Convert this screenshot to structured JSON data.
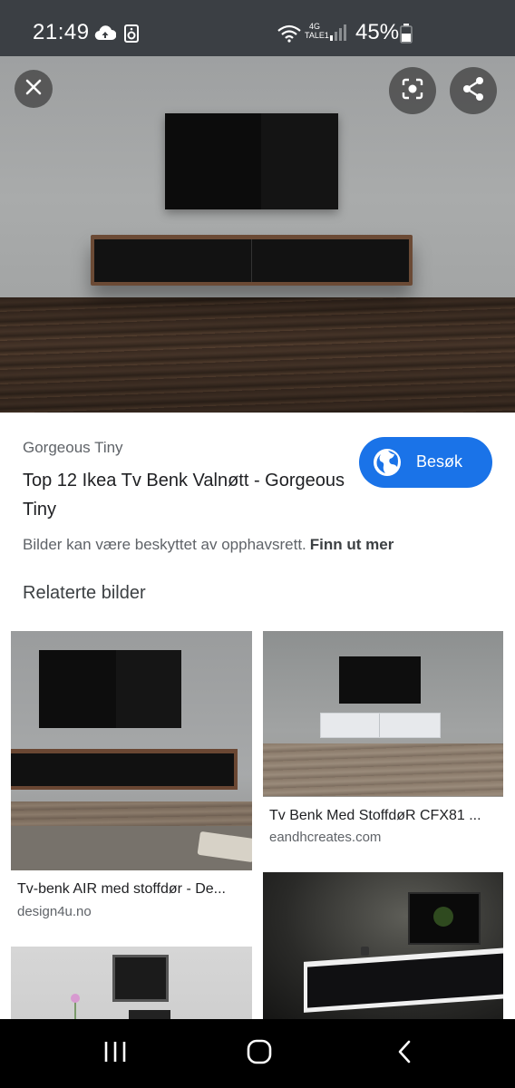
{
  "status_bar": {
    "time": "21:49",
    "battery": "45%",
    "network": "4G",
    "carrier": "TALE1",
    "icons": [
      "cloud-upload-icon",
      "speaker-icon",
      "wifi-icon",
      "signal-icon",
      "battery-icon"
    ]
  },
  "viewer": {
    "close_icon": "close-icon",
    "lens_icon": "google-lens-icon",
    "share_icon": "share-icon"
  },
  "result": {
    "source": "Gorgeous Tiny",
    "title": "Top 12 Ikea Tv Benk Valnøtt - Gorgeous Tiny",
    "visit_label": "Besøk",
    "copyright_notice": "Bilder kan være beskyttet av opphavsrett.",
    "learn_more": "Finn ut mer"
  },
  "related": {
    "heading": "Relaterte bilder",
    "items": [
      {
        "title": "Tv-benk AIR med stoffdør - De...",
        "domain": "design4u.no"
      },
      {
        "title": "Tv Benk Med StoffdøR CFX81 ...",
        "domain": "eandhcreates.com"
      },
      {
        "title": "",
        "domain": ""
      },
      {
        "title": "",
        "domain": ""
      }
    ]
  },
  "colors": {
    "accent": "#1a73e8",
    "status_bar": "#3b3f44",
    "nav_bar": "#000000"
  }
}
